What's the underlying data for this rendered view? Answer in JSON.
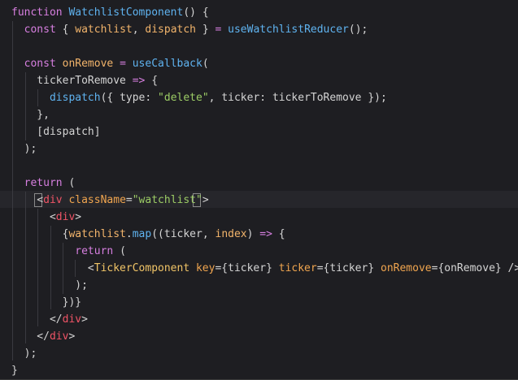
{
  "colors": {
    "background": "#1e1e22",
    "keyword": "#d77fe0",
    "function": "#5fb3f0",
    "variable": "#f2b46b",
    "string": "#9ccc65",
    "tag": "#ef5466",
    "component": "#f0c467",
    "attribute": "#f0a54f",
    "default": "#d4d4d4"
  },
  "lines": [
    [
      [
        "function ",
        "keyword"
      ],
      [
        "WatchlistComponent",
        "function"
      ],
      [
        "() {",
        "default"
      ]
    ],
    [
      [
        "  ",
        "default"
      ],
      [
        "const",
        "keyword"
      ],
      [
        " { ",
        "default"
      ],
      [
        "watchlist",
        "variable"
      ],
      [
        ", ",
        "default"
      ],
      [
        "dispatch",
        "variable"
      ],
      [
        " } ",
        "default"
      ],
      [
        "=",
        "keyword"
      ],
      [
        " ",
        "default"
      ],
      [
        "useWatchlistReducer",
        "function"
      ],
      [
        "();",
        "default"
      ]
    ],
    [],
    [
      [
        "  ",
        "default"
      ],
      [
        "const",
        "keyword"
      ],
      [
        " ",
        "default"
      ],
      [
        "onRemove",
        "variable"
      ],
      [
        " ",
        "default"
      ],
      [
        "=",
        "keyword"
      ],
      [
        " ",
        "default"
      ],
      [
        "useCallback",
        "function"
      ],
      [
        "(",
        "default"
      ]
    ],
    [
      [
        "    tickerToRemove ",
        "default"
      ],
      [
        "=>",
        "keyword"
      ],
      [
        " {",
        "default"
      ]
    ],
    [
      [
        "      ",
        "default"
      ],
      [
        "dispatch",
        "function"
      ],
      [
        "({ type: ",
        "default"
      ],
      [
        "\"delete\"",
        "string"
      ],
      [
        ", ticker: tickerToRemove });",
        "default"
      ]
    ],
    [
      [
        "    },",
        "default"
      ]
    ],
    [
      [
        "    [dispatch]",
        "default"
      ]
    ],
    [
      [
        "  );",
        "default"
      ]
    ],
    [],
    [
      [
        "  ",
        "default"
      ],
      [
        "return",
        "keyword"
      ],
      [
        " (",
        "default"
      ]
    ],
    [
      [
        "    <",
        "default"
      ],
      [
        "div",
        "tag"
      ],
      [
        " ",
        "default"
      ],
      [
        "className",
        "attribute"
      ],
      [
        "=",
        "default"
      ],
      [
        "\"watchlist\"",
        "string"
      ],
      [
        ">",
        "default"
      ]
    ],
    [
      [
        "      <",
        "default"
      ],
      [
        "div",
        "tag"
      ],
      [
        ">",
        "default"
      ]
    ],
    [
      [
        "        {",
        "default"
      ],
      [
        "watchlist",
        "variable"
      ],
      [
        ".",
        "default"
      ],
      [
        "map",
        "function"
      ],
      [
        "((ticker, ",
        "default"
      ],
      [
        "index",
        "variable"
      ],
      [
        ") ",
        "default"
      ],
      [
        "=>",
        "keyword"
      ],
      [
        " {",
        "default"
      ]
    ],
    [
      [
        "          ",
        "default"
      ],
      [
        "return",
        "keyword"
      ],
      [
        " (",
        "default"
      ]
    ],
    [
      [
        "            <",
        "default"
      ],
      [
        "TickerComponent",
        "component"
      ],
      [
        " ",
        "default"
      ],
      [
        "key",
        "attribute"
      ],
      [
        "={ticker} ",
        "default"
      ],
      [
        "ticker",
        "attribute"
      ],
      [
        "={ticker} ",
        "default"
      ],
      [
        "onRemove",
        "attribute"
      ],
      [
        "={onRemove} />",
        "default"
      ]
    ],
    [
      [
        "          );",
        "default"
      ]
    ],
    [
      [
        "        })}",
        "default"
      ]
    ],
    [
      [
        "      </",
        "default"
      ],
      [
        "div",
        "tag"
      ],
      [
        ">",
        "default"
      ]
    ],
    [
      [
        "    </",
        "default"
      ],
      [
        "div",
        "tag"
      ],
      [
        ">",
        "default"
      ]
    ],
    [
      [
        "  );",
        "default"
      ]
    ],
    [
      [
        "}",
        "default"
      ]
    ]
  ]
}
